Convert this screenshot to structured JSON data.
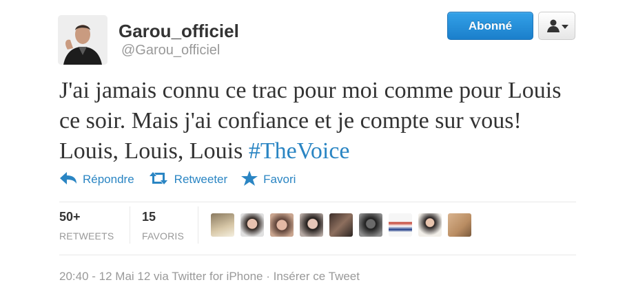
{
  "user": {
    "name": "Garou_officiel",
    "handle": "@Garou_officiel"
  },
  "buttons": {
    "follow_label": "Abonné"
  },
  "tweet": {
    "text": "J'ai jamais connu ce trac pour moi comme pour Louis ce soir. Mais j'ai confiance et je compte sur vous! Louis, Louis, Louis ",
    "hashtag": "#TheVoice"
  },
  "actions": {
    "reply": "Répondre",
    "retweet": "Retweeter",
    "favorite": "Favori"
  },
  "stats": {
    "retweets": {
      "count": "50+",
      "label": "RETWEETS"
    },
    "favorites": {
      "count": "15",
      "label": "FAVORIS"
    }
  },
  "meta": {
    "time": "20:40 - 12 Mai 12",
    "via": "via Twitter for iPhone",
    "sep": "·",
    "embed": "Insérer ce Tweet"
  },
  "colors": {
    "link": "#2a85c3",
    "button": "#1b7fcb",
    "muted": "#999999"
  },
  "icons": [
    "reply-icon",
    "retweet-icon",
    "star-icon",
    "user-icon",
    "chevron-down-icon"
  ]
}
